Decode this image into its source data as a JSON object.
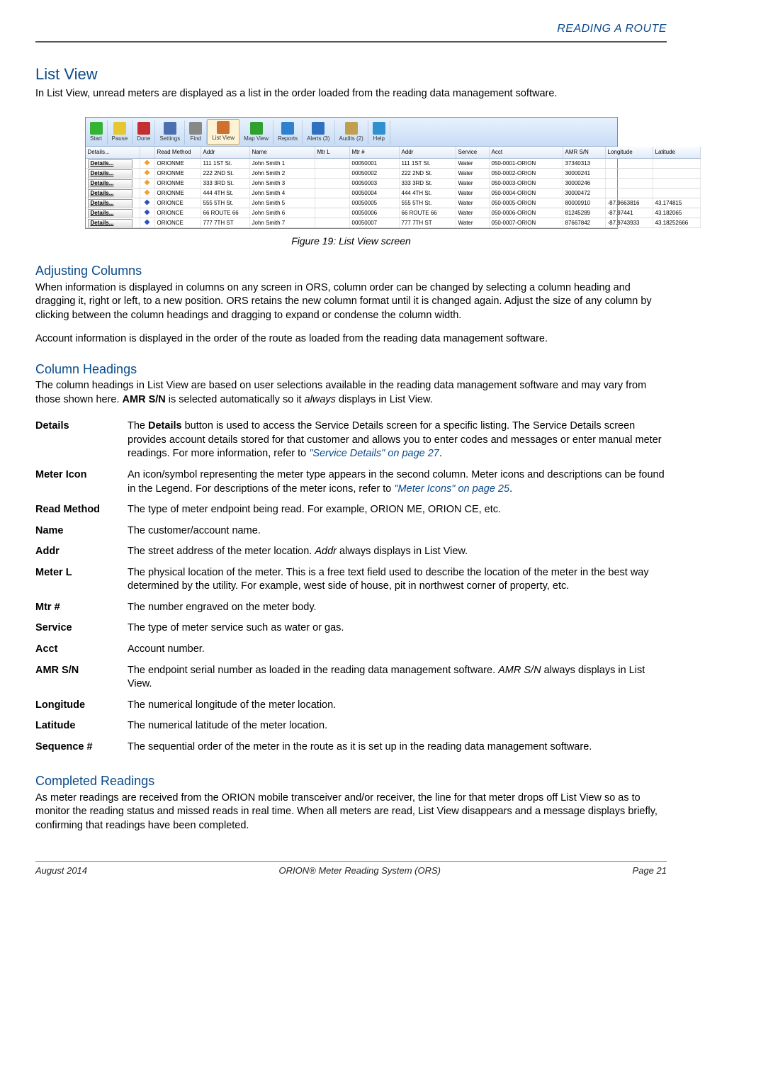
{
  "header": {
    "breadcrumb": "READING A ROUTE"
  },
  "h1": "List View",
  "intro": "In List View, unread meters are displayed as a list in the order loaded from the reading data management software.",
  "toolbar": {
    "buttons": [
      {
        "label": "Start",
        "name": "start-button"
      },
      {
        "label": "Pause",
        "name": "pause-button"
      },
      {
        "label": "Done",
        "name": "done-button"
      },
      {
        "label": "Settings",
        "name": "settings-button"
      },
      {
        "label": "Find",
        "name": "find-button"
      },
      {
        "label": "List View",
        "name": "list-view-button",
        "selected": true
      },
      {
        "label": "Map View",
        "name": "map-view-button"
      },
      {
        "label": "Reports",
        "name": "reports-button"
      },
      {
        "label": "Alerts (3)",
        "name": "alerts-button"
      },
      {
        "label": "Audits (2)",
        "name": "audits-button"
      },
      {
        "label": "Help",
        "name": "help-button"
      }
    ]
  },
  "columns": [
    "Details...",
    "",
    "Read Method",
    "Addr",
    "Name",
    "Mtr L",
    "Mtr #",
    "Addr",
    "Service",
    "Acct",
    "AMR S/N",
    "Longitude",
    "Latitude"
  ],
  "rows": [
    {
      "details": "Details...",
      "icon": "orionme",
      "rm": "ORIONME",
      "addr1": "111 1ST St.",
      "name": "John Smith 1",
      "mtrl": "",
      "mtrnum": "00050001",
      "addr2": "111 1ST St.",
      "svc": "Water",
      "acct": "050-0001-ORION",
      "amr": "37340313",
      "lon": "",
      "lat": ""
    },
    {
      "details": "Details...",
      "icon": "orionme",
      "rm": "ORIONME",
      "addr1": "222 2ND St.",
      "name": "John Smith 2",
      "mtrl": "",
      "mtrnum": "00050002",
      "addr2": "222 2ND St.",
      "svc": "Water",
      "acct": "050-0002-ORION",
      "amr": "30000241",
      "lon": "",
      "lat": ""
    },
    {
      "details": "Details...",
      "icon": "orionme",
      "rm": "ORIONME",
      "addr1": "333 3RD St.",
      "name": "John Smith 3",
      "mtrl": "",
      "mtrnum": "00050003",
      "addr2": "333 3RD St.",
      "svc": "Water",
      "acct": "050-0003-ORION",
      "amr": "30000246",
      "lon": "",
      "lat": ""
    },
    {
      "details": "Details...",
      "icon": "orionme",
      "rm": "ORIONME",
      "addr1": "444 4TH St.",
      "name": "John Smith 4",
      "mtrl": "",
      "mtrnum": "00050004",
      "addr2": "444 4TH St.",
      "svc": "Water",
      "acct": "050-0004-ORION",
      "amr": "30000472",
      "lon": "",
      "lat": ""
    },
    {
      "details": "Details...",
      "icon": "orionce",
      "rm": "ORIONCE",
      "addr1": "555 5TH St.",
      "name": "John Smith 5",
      "mtrl": "",
      "mtrnum": "00050005",
      "addr2": "555 5TH St.",
      "svc": "Water",
      "acct": "050-0005-ORION",
      "amr": "80000910",
      "lon": "-87.9663816",
      "lat": "43.174815"
    },
    {
      "details": "Details...",
      "icon": "orionce",
      "rm": "ORIONCE",
      "addr1": "66 ROUTE 66",
      "name": "John Smith 6",
      "mtrl": "",
      "mtrnum": "00050006",
      "addr2": "66 ROUTE 66",
      "svc": "Water",
      "acct": "050-0006-ORION",
      "amr": "81245289",
      "lon": "-87.97441",
      "lat": "43.182065"
    },
    {
      "details": "Details...",
      "icon": "orionce",
      "rm": "ORIONCE",
      "addr1": "777 7TH ST",
      "name": "John Smith 7",
      "mtrl": "",
      "mtrnum": "00050007",
      "addr2": "777 7TH ST",
      "svc": "Water",
      "acct": "050-0007-ORION",
      "amr": "87667842",
      "lon": "-87.9743933",
      "lat": "43.18252666"
    }
  ],
  "figure_caption": "Figure 19:  List View screen",
  "adj_heading": "Adjusting Columns",
  "adj_p1": "When information is displayed in columns on any screen in ORS, column order can be changed by selecting a column heading and dragging it, right or left, to a new position. ORS retains the new column format until it is changed again. Adjust the size of any column by clicking between the column headings and dragging to expand or condense the column width.",
  "adj_p2": "Account information is displayed in the order of the route as loaded from the reading data management software.",
  "col_heading": "Column Headings",
  "col_intro_a": "The column headings in List View are based on user selections available in the reading data management software and may vary from those shown here. ",
  "col_intro_b": "AMR S/N",
  "col_intro_c": " is selected automatically so it ",
  "col_intro_d": "always",
  "col_intro_e": " displays in List View.",
  "defs": {
    "details": {
      "term": "Details",
      "a": "The ",
      "b": "Details",
      "c": " button is used to access the Service Details screen for a specific listing. The Service Details screen provides account details stored for that customer and allows you to enter codes and messages or enter manual meter readings. For more information, refer to ",
      "link": "\"Service Details\" on page 27",
      "d": "."
    },
    "metericon": {
      "term": "Meter Icon",
      "a": "An icon/symbol representing the meter type appears in the second column. Meter icons and descriptions can be found in the Legend. For descriptions of the meter icons, refer to ",
      "link": "\"Meter Icons\" on page 25",
      "b": "."
    },
    "readmethod": {
      "term": "Read Method",
      "desc": "The type of meter endpoint being read. For example, ORION ME, ORION CE, etc."
    },
    "name": {
      "term": "Name",
      "desc": "The customer/account name."
    },
    "addr": {
      "term": "Addr",
      "a": "The street address of the meter location. ",
      "i": "Addr",
      "b": " always displays in List View."
    },
    "meterl": {
      "term": "Meter L",
      "desc": "The physical location of the meter. This is a free text field used to describe the location of the meter in the best way determined by the utility. For example, west side of house, pit in northwest corner of property, etc."
    },
    "mtrnum": {
      "term": "Mtr #",
      "desc": "The number engraved on the meter body."
    },
    "service": {
      "term": "Service",
      "desc": "The type of meter service such as water or gas."
    },
    "acct": {
      "term": "Acct",
      "desc": "Account number."
    },
    "amr": {
      "term": "AMR S/N",
      "a": "The endpoint serial number as loaded in the reading data management software. ",
      "i": "AMR S/N",
      "b": " always displays in List View."
    },
    "lon": {
      "term": "Longitude",
      "desc": "The numerical longitude of the meter location."
    },
    "lat": {
      "term": "Latitude",
      "desc": "The numerical latitude of the meter location."
    },
    "seq": {
      "term": "Sequence #",
      "desc": "The sequential order of the meter in the route as it is set up in the reading data management software."
    }
  },
  "comp_heading": "Completed Readings",
  "comp_p": "As meter readings are received from the ORION mobile transceiver and/or receiver, the line for that meter drops off List View so as to monitor the reading status and missed reads in real time. When all meters are read, List View disappears and a message displays briefly, confirming that readings have been completed.",
  "footer": {
    "left": "August 2014",
    "center": "ORION® Meter Reading System (ORS)",
    "right": "Page 21"
  }
}
